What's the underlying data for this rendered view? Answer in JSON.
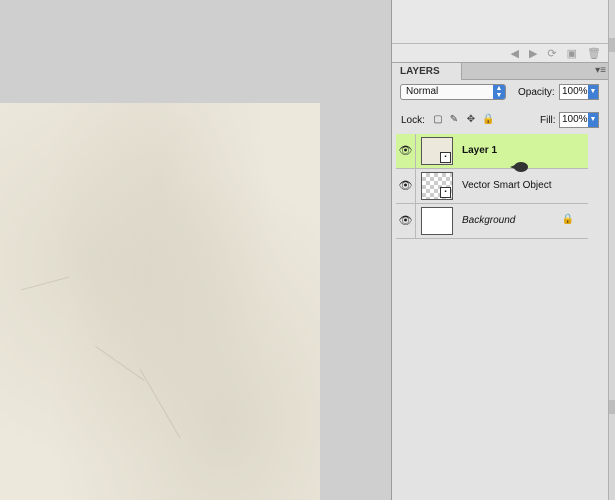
{
  "history_toolbar": {
    "icons": [
      "step-backward-icon",
      "step-forward-icon",
      "reset-icon",
      "new-snapshot-icon",
      "trash-icon"
    ]
  },
  "layers_panel": {
    "tab_label": "LAYERS",
    "blend_mode": "Normal",
    "opacity_label": "Opacity:",
    "opacity_value": "100%",
    "lock_label": "Lock:",
    "fill_label": "Fill:",
    "fill_value": "100%",
    "layers": [
      {
        "name": "Layer 1",
        "selected": true,
        "visible": true,
        "thumb": "paper-texture"
      },
      {
        "name": "Vector Smart Object",
        "selected": false,
        "visible": true,
        "thumb": "smart-object"
      },
      {
        "name": "Background",
        "selected": false,
        "visible": true,
        "thumb": "white",
        "locked": true
      }
    ]
  },
  "colors": {
    "selected_layer": "#d2f59c",
    "panel_bg": "#e3e3e3",
    "canvas_bg": "#cfcfcf",
    "document_paper": "#ece8dc",
    "accent_blue": "#3f7fd6"
  }
}
